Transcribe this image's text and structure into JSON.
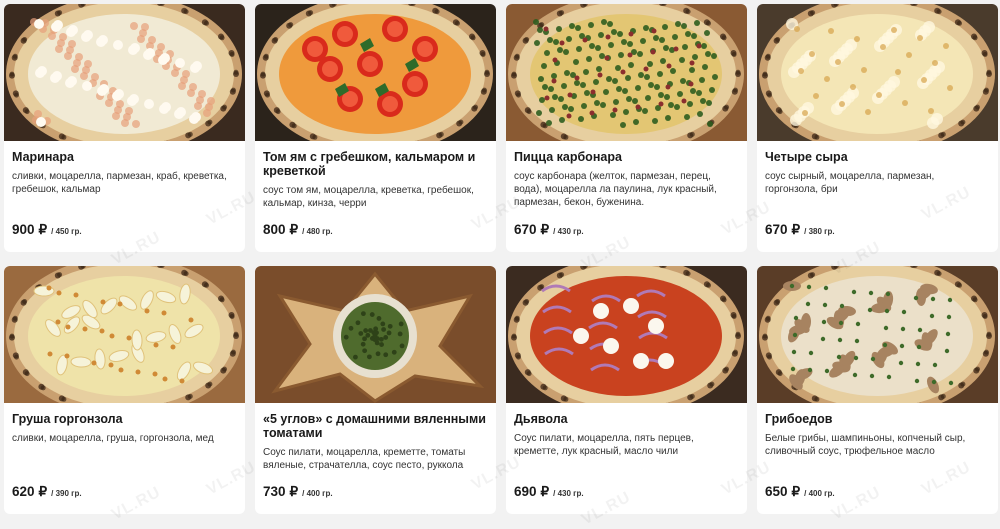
{
  "watermark": "VL.RU",
  "items": [
    {
      "title": "Маринара",
      "description": "сливки, моцарелла, пармезан, краб, креветка, гребешок, кальмар",
      "price": "900",
      "currency": "₽",
      "weight": "/ 450 гр.",
      "photo": "pizza-seafood-cream"
    },
    {
      "title": "Том ям с гребешком, кальмаром и креветкой",
      "description": "соус том ям, моцарелла, креветка, гребешок, кальмар, кинза, черри",
      "price": "800",
      "currency": "₽",
      "weight": "/ 480 гр.",
      "photo": "pizza-tomatoes-herbs"
    },
    {
      "title": "Пицца карбонара",
      "description": "соус карбонара (желток, пармезан, перец, вода), моцарелла ла паулина, лук красный, пармезан, бекон, буженина.",
      "price": "670",
      "currency": "₽",
      "weight": "/ 430 гр.",
      "photo": "pizza-carbonara-greens"
    },
    {
      "title": "Четыре сыра",
      "description": "соус сырный, моцарелла, пармезан, горгонзола, бри",
      "price": "670",
      "currency": "₽",
      "weight": "/ 380 гр.",
      "photo": "pizza-four-cheese"
    },
    {
      "title": "Груша горгонзола",
      "description": "сливки, моцарелла, груша, горгонзола, мед",
      "price": "620",
      "currency": "₽",
      "weight": "/ 390 гр.",
      "photo": "pizza-pear-gorgonzola"
    },
    {
      "title": "«5 углов» с домашними вяленными томатами",
      "description": "Соус пилати, моцарелла, креметте, томаты вяленые, страчателла, соус песто, руккола",
      "price": "730",
      "currency": "₽",
      "weight": "/ 400 гр.",
      "photo": "pizza-star-shape"
    },
    {
      "title": "Дьявола",
      "description": "Соус пилати, моцарелла, пять перцев, креметте, лук красный, масло чили",
      "price": "690",
      "currency": "₽",
      "weight": "/ 430 гр.",
      "photo": "pizza-diavola"
    },
    {
      "title": "Грибоедов",
      "description": "Белые грибы, шампиньоны, копченый сыр, сливочный соус, трюфельное масло",
      "price": "650",
      "currency": "₽",
      "weight": "/ 400 гр.",
      "photo": "pizza-mushrooms"
    }
  ]
}
